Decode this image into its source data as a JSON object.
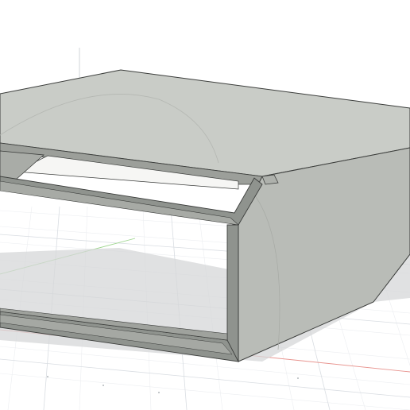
{
  "viewport": {
    "background": "#ffffff",
    "grid_color": "#d9dde2",
    "grid_minor_color": "#eceef1",
    "x_axis_color": "#e8948f",
    "y_axis_color": "#9fd68f",
    "z_axis_color": "#c7cbd0",
    "shadow_color": "#d6d7d8"
  },
  "model": {
    "face_top_color": "#c9ccc7",
    "face_side_color": "#b9bcb7",
    "face_inner_color": "#a9aca7",
    "edge_color": "#3b3d3b",
    "bevel_color": "#8f938e"
  }
}
